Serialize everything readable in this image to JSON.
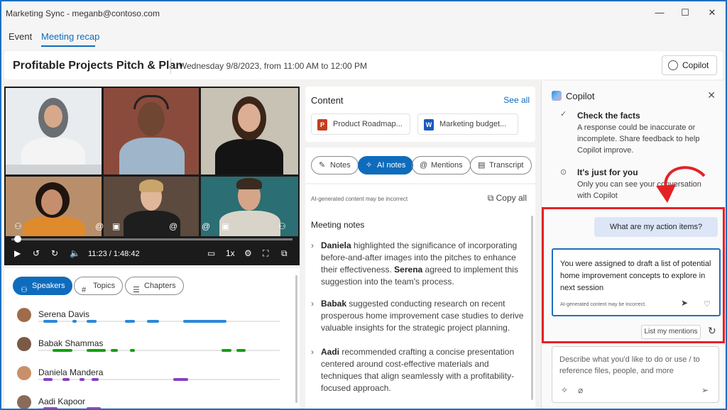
{
  "window": {
    "title": "Marketing Sync - meganb@contoso.com",
    "controls": {
      "minimize": "—",
      "maximize": "☐",
      "close": "✕"
    }
  },
  "tabs": [
    {
      "label": "Event",
      "active": false
    },
    {
      "label": "Meeting recap",
      "active": true
    }
  ],
  "header": {
    "title": "Profitable Projects Pitch & Plan",
    "date": "Wednesday 9/8/2023, from 11:00 AM to 12:00 PM",
    "copilot_label": "Copilot"
  },
  "player": {
    "time": "11:23 / 1:48:42",
    "speed": "1x",
    "progress": 0.02
  },
  "speaker_tabs": [
    {
      "label": "Speakers",
      "selected": true,
      "icon": "people-icon",
      "glyph": "⚇"
    },
    {
      "label": "Topics",
      "selected": false,
      "icon": "hash-icon",
      "glyph": "#"
    },
    {
      "label": "Chapters",
      "selected": false,
      "icon": "list-icon",
      "glyph": "☰"
    }
  ],
  "speakers": [
    {
      "name": "Serena Davis",
      "color": "#2b88d8",
      "segments": [
        [
          0.02,
          0.08
        ],
        [
          0.14,
          0.16
        ],
        [
          0.2,
          0.24
        ],
        [
          0.36,
          0.4
        ],
        [
          0.45,
          0.5
        ],
        [
          0.6,
          0.78
        ]
      ]
    },
    {
      "name": "Babak Shammas",
      "color": "#13a10e",
      "segments": [
        [
          0.06,
          0.14
        ],
        [
          0.2,
          0.28
        ],
        [
          0.3,
          0.33
        ],
        [
          0.38,
          0.4
        ],
        [
          0.76,
          0.8
        ],
        [
          0.82,
          0.86
        ]
      ]
    },
    {
      "name": "Daniela Mandera",
      "color": "#8a3fc1",
      "segments": [
        [
          0.02,
          0.06
        ],
        [
          0.1,
          0.13
        ],
        [
          0.17,
          0.19
        ],
        [
          0.22,
          0.25
        ],
        [
          0.56,
          0.62
        ]
      ]
    },
    {
      "name": "Aadi Kapoor",
      "color": "#c239b3",
      "segments": [
        [
          0.02,
          0.08
        ],
        [
          0.2,
          0.26
        ]
      ]
    }
  ],
  "content": {
    "title": "Content",
    "see_all": "See all",
    "files": [
      {
        "name": "Product Roadmap...",
        "type": "ppt",
        "color": "#c43e1c",
        "glyph": "P"
      },
      {
        "name": "Marketing budget...",
        "type": "word",
        "color": "#185abd",
        "glyph": "W"
      }
    ]
  },
  "notes_tabs": [
    {
      "label": "Notes",
      "selected": false,
      "glyph": "✎"
    },
    {
      "label": "AI notes",
      "selected": true,
      "glyph": "✧"
    },
    {
      "label": "Mentions",
      "selected": false,
      "glyph": "@"
    },
    {
      "label": "Transcript",
      "selected": false,
      "glyph": "▤"
    }
  ],
  "notes": {
    "disclaimer": "AI-generated content may be incorrect",
    "copy_all": "Copy all",
    "heading": "Meeting notes",
    "items": [
      {
        "parts": [
          [
            "b",
            "Daniela"
          ],
          [
            "t",
            " highlighted the significance of incorporating before-and-after images into the pitches to enhance their effectiveness. "
          ],
          [
            "b",
            "Serena"
          ],
          [
            "t",
            " agreed to implement this suggestion into the team's process."
          ]
        ]
      },
      {
        "parts": [
          [
            "b",
            "Babak"
          ],
          [
            "t",
            " suggested conducting research on recent prosperous home improvement case studies to derive valuable insights for the strategic project planning."
          ]
        ]
      },
      {
        "parts": [
          [
            "b",
            "Aadi"
          ],
          [
            "t",
            " recommended crafting a concise presentation centered around cost-effective materials and techniques that align seamlessly with a profitability-focused approach."
          ]
        ]
      }
    ]
  },
  "copilot": {
    "title": "Copilot",
    "tips": [
      {
        "heading": "Check the facts",
        "body": "A response could be inaccurate or incomplete. Share feedback to help Copilot improve."
      },
      {
        "heading": "It's just for you",
        "body": "Only you can see your conversation with Copilot"
      }
    ],
    "user_message": "What are my action items?",
    "response": "You were assigned to draft a list of potential home improvement concepts to explore in next session",
    "response_disclaimer": "AI-generated content may be incorrect.",
    "suggestion": "List my mentions",
    "compose_placeholder": "Describe what you'd like to do or use / to reference files, people, and more",
    "highlight_color": "#e32227"
  }
}
